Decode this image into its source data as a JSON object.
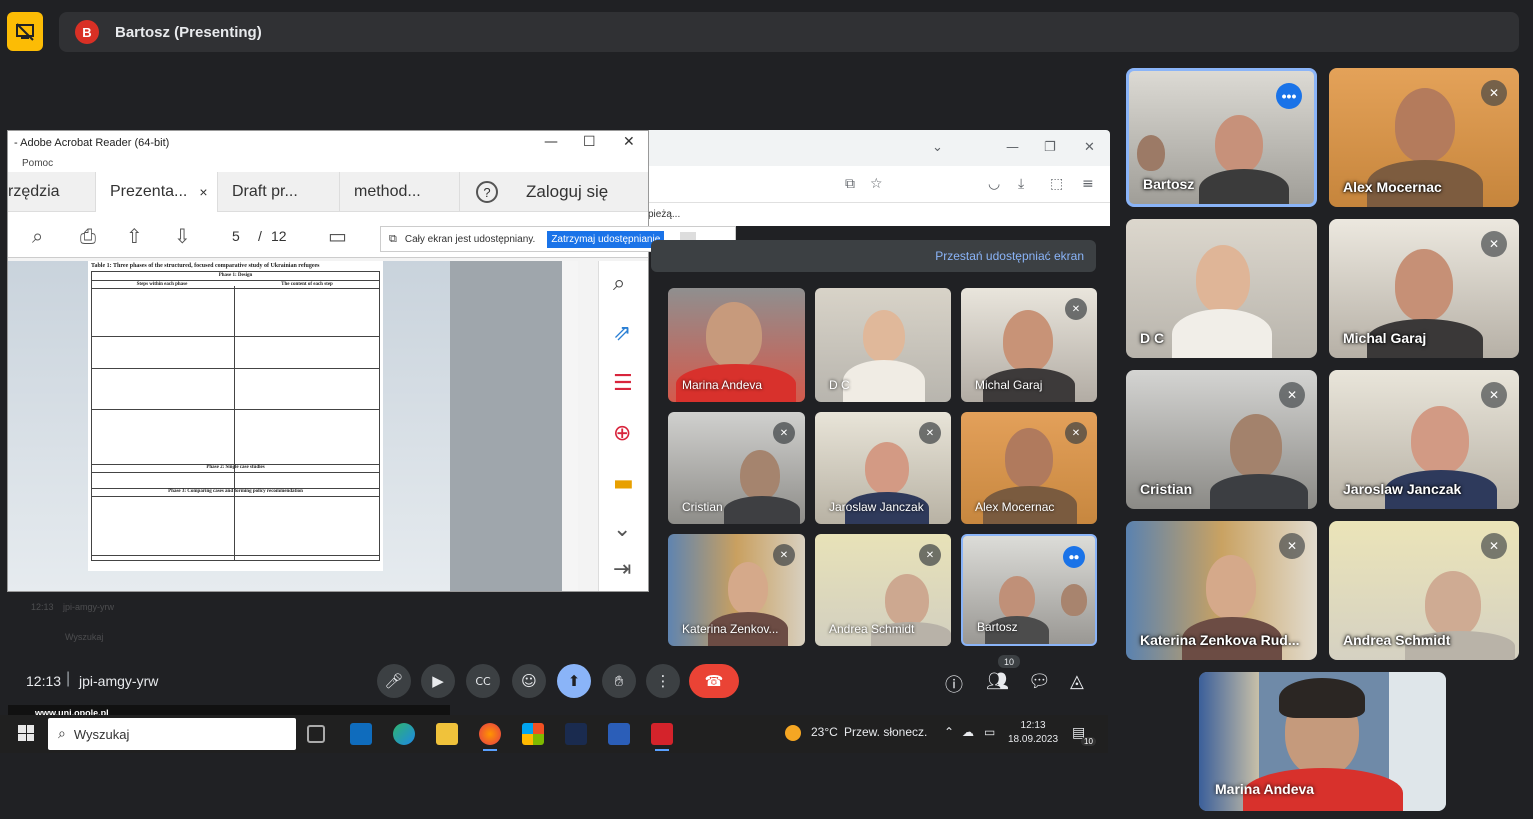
{
  "meet": {
    "presenter_initial": "B",
    "presenter_label": "Bartosz (Presenting)",
    "time": "12:13",
    "separator": "|",
    "meeting_code": "jpi-amgy-yrw",
    "participants_count": "10",
    "stop_sharing_label": "Przestań udostępniać ekran"
  },
  "acrobat": {
    "window_title": "- Adobe Acrobat Reader (64-bit)",
    "menu": "Pomoc",
    "tabs": [
      {
        "label": "rzędzia"
      },
      {
        "label": "Prezenta...",
        "close": "×"
      },
      {
        "label": "Draft pr..."
      },
      {
        "label": "method..."
      }
    ],
    "help": "?",
    "login": "Zaloguj się",
    "page_current": "5",
    "page_sep": "/",
    "page_total": "12",
    "doc_table_title": "Table 1: Three phases of the structured, focused comparative study of Ukrainian refugees",
    "doc_phase1": "Phase 1: Design",
    "doc_col1": "Steps within each phase",
    "doc_col2": "The content of each step",
    "doc_phase2": "Phase 2: Single case studies",
    "doc_phase3": "Phase 3: Comparing cases and forming policy recommendation",
    "footer": "www.uni.opole.pl"
  },
  "share_toast": {
    "text": "Cały ekran jest udostępniany.",
    "stop": "Zatrzymaj udostępnianie",
    "minimize": "_"
  },
  "browser": {
    "bookmark": "pieżą..."
  },
  "inner_tiles": [
    {
      "name": "Marina Andeva",
      "muted": false
    },
    {
      "name": "D C",
      "muted": false
    },
    {
      "name": "Michal Garaj",
      "muted": true
    },
    {
      "name": "Cristian",
      "muted": true
    },
    {
      "name": "Jaroslaw Janczak",
      "muted": true
    },
    {
      "name": "Alex Mocernac",
      "muted": true
    },
    {
      "name": "Katerina Zenkov...",
      "muted": true
    },
    {
      "name": "Andrea Schmidt",
      "muted": true
    },
    {
      "name": "Bartosz",
      "muted": false
    }
  ],
  "tiles": [
    {
      "name": "Bartosz",
      "more": "•••"
    },
    {
      "name": "Alex Mocernac",
      "muted": true
    },
    {
      "name": "D C",
      "muted": false
    },
    {
      "name": "Michal Garaj",
      "muted": true
    },
    {
      "name": "Cristian",
      "muted": true
    },
    {
      "name": "Jaroslaw Janczak",
      "muted": true
    },
    {
      "name": "Katerina Zenkova Rud...",
      "muted": true
    },
    {
      "name": "Andrea Schmidt",
      "muted": true
    }
  ],
  "self_view": {
    "name": "Marina Andeva"
  },
  "taskbar": {
    "search_placeholder": "Wyszukaj",
    "weather_temp": "23°C",
    "weather_text": "Przew. słonecz.",
    "clock_time": "12:13",
    "clock_date": "18.09.2023",
    "notif_count": "10"
  }
}
